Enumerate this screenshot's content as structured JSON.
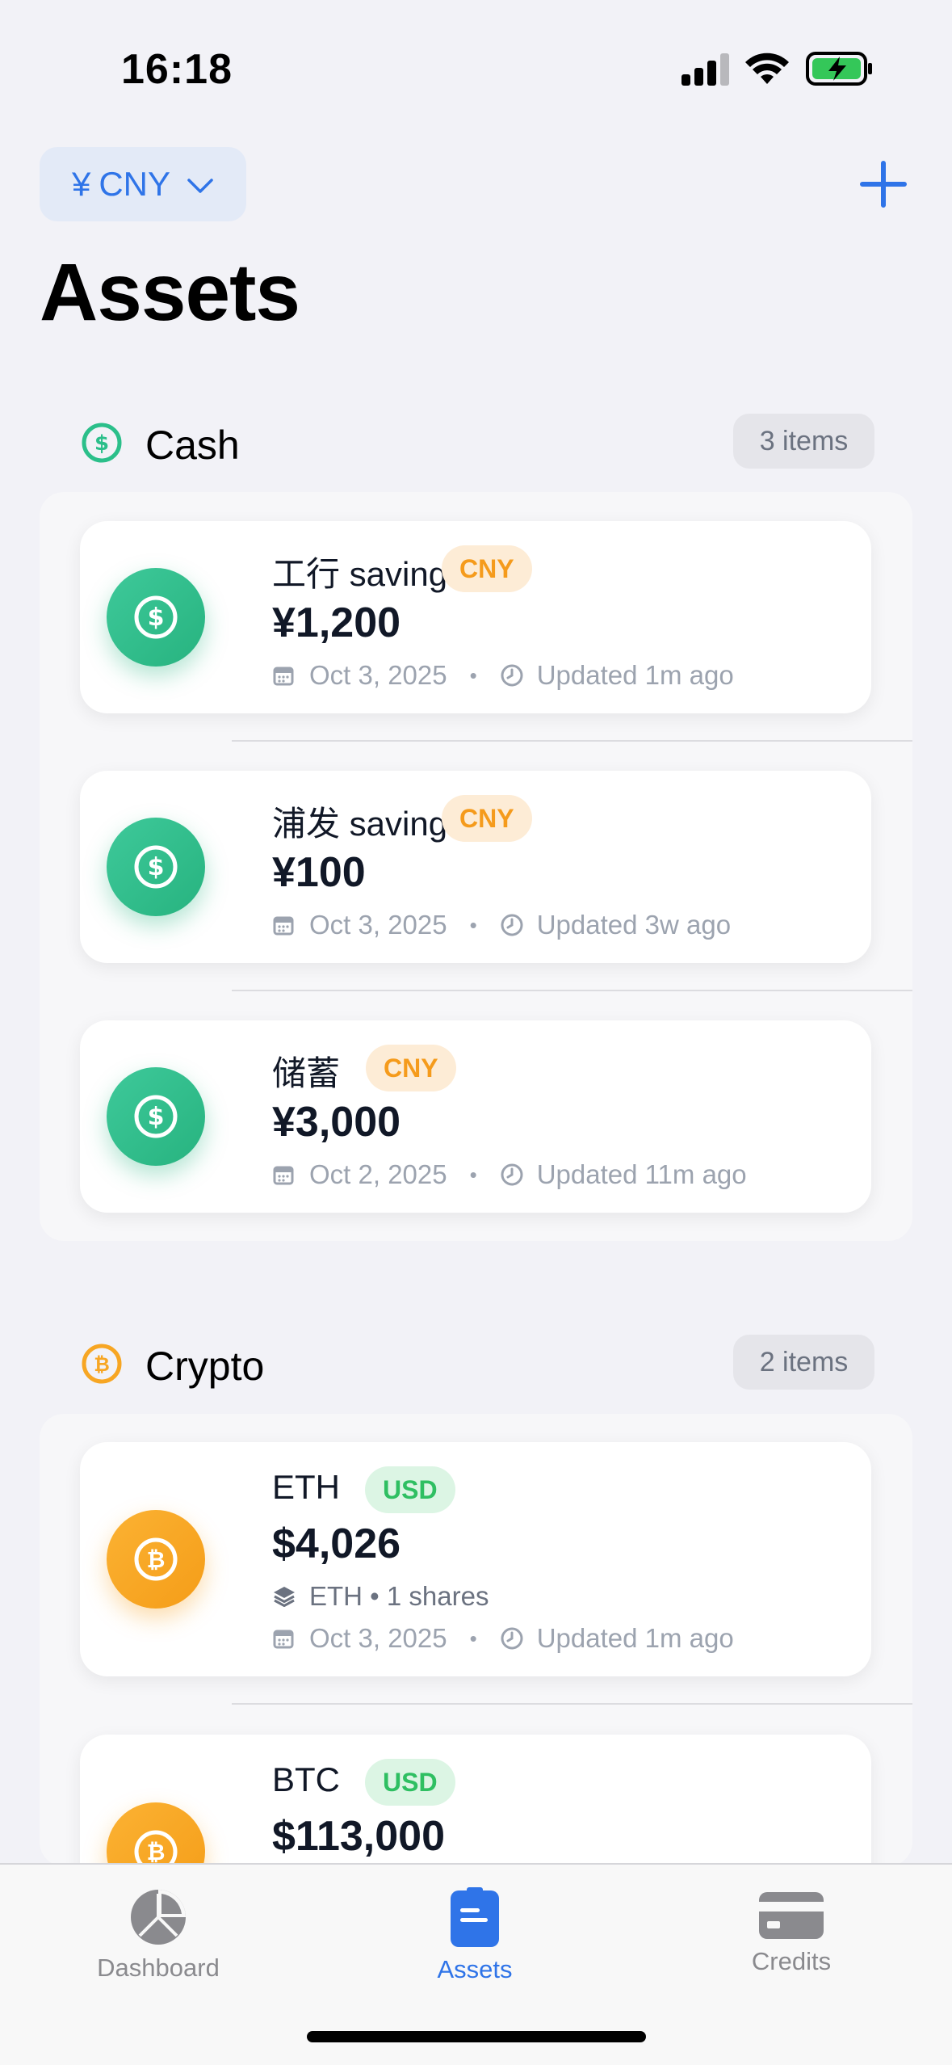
{
  "status_bar": {
    "time": "16:18"
  },
  "header": {
    "currency_symbol": "¥",
    "currency_code": "CNY",
    "title": "Assets"
  },
  "colors": {
    "accent": "#2f74e8",
    "cash_green": "#2bbf8a",
    "crypto_orange": "#f7a623",
    "cny_tag_text": "#f59b1c",
    "usd_tag_text": "#2fbf62"
  },
  "sections": [
    {
      "title": "Cash",
      "icon": "dollar-circle-icon",
      "count": "3 items",
      "items": [
        {
          "name": "工行 saving",
          "currency": "CNY",
          "amount": "¥1,200",
          "date": "Oct 3, 2025",
          "updated": "Updated 1m ago"
        },
        {
          "name": "浦发 saving",
          "currency": "CNY",
          "amount": "¥100",
          "date": "Oct 3, 2025",
          "updated": "Updated 3w ago"
        },
        {
          "name": "储蓄",
          "currency": "CNY",
          "amount": "¥3,000",
          "date": "Oct 2, 2025",
          "updated": "Updated 11m ago"
        }
      ]
    },
    {
      "title": "Crypto",
      "icon": "bitcoin-circle-icon",
      "count": "2 items",
      "items": [
        {
          "name": "ETH",
          "currency": "USD",
          "amount": "$4,026",
          "shares": "ETH • 1 shares",
          "date": "Oct 3, 2025",
          "updated": "Updated 1m ago"
        },
        {
          "name": "BTC",
          "currency": "USD",
          "amount": "$113,000"
        }
      ]
    }
  ],
  "tabs": [
    {
      "label": "Dashboard",
      "icon": "pie-chart-icon",
      "active": false
    },
    {
      "label": "Assets",
      "icon": "wallet-icon",
      "active": true
    },
    {
      "label": "Credits",
      "icon": "credit-card-icon",
      "active": false
    }
  ]
}
